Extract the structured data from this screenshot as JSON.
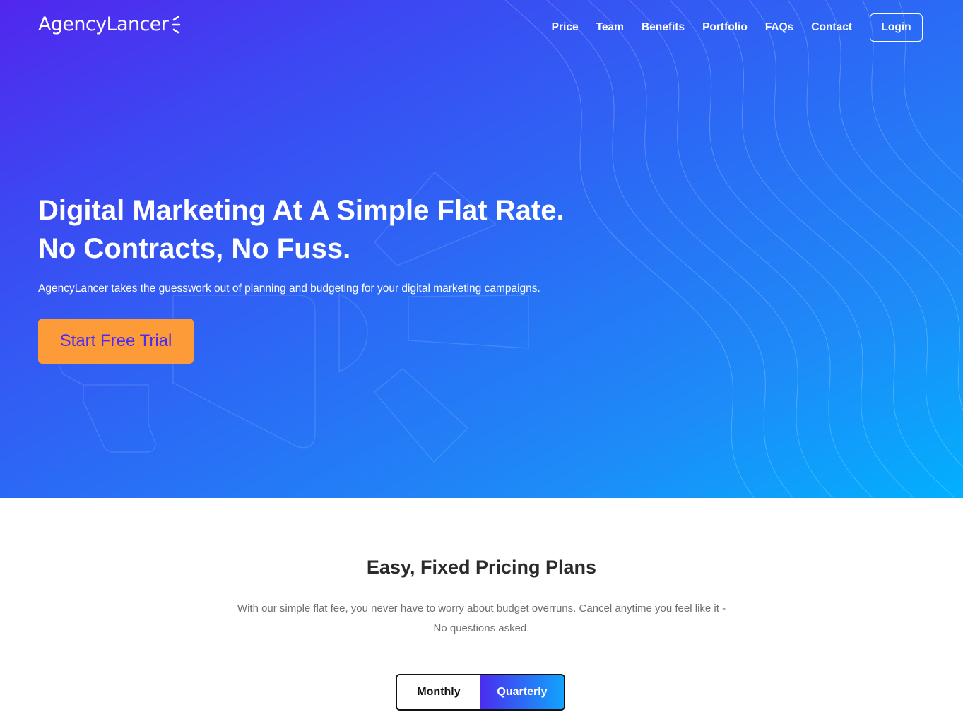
{
  "brand": {
    "name": "AgencyLancer",
    "logo_icon": "logo-mark-icon"
  },
  "nav": {
    "links": [
      "Price",
      "Team",
      "Benefits",
      "Portfolio",
      "FAQs",
      "Contact"
    ],
    "login_label": "Login"
  },
  "hero": {
    "title_line1": "Digital Marketing At A Simple Flat Rate.",
    "title_line2": "No Contracts, No Fuss.",
    "subtitle": "AgencyLancer takes the guesswork out of planning and budgeting for your digital marketing campaigns.",
    "cta_label": "Start Free Trial",
    "decoration_icon": "megaphone-icon"
  },
  "pricing": {
    "title": "Easy, Fixed Pricing Plans",
    "description": "With our simple flat fee, you never have to worry about budget overruns. Cancel anytime you feel like it - No questions asked.",
    "toggle": {
      "options": [
        "Monthly",
        "Quarterly"
      ],
      "selected": "Quarterly"
    }
  },
  "colors": {
    "hero_gradient_start": "#5226ee",
    "hero_gradient_end": "#02b0fe",
    "cta_background": "#fd9b38",
    "cta_text": "#4b2cf0",
    "heading_text": "#2b2b2b",
    "body_text": "#6f6f6f"
  }
}
